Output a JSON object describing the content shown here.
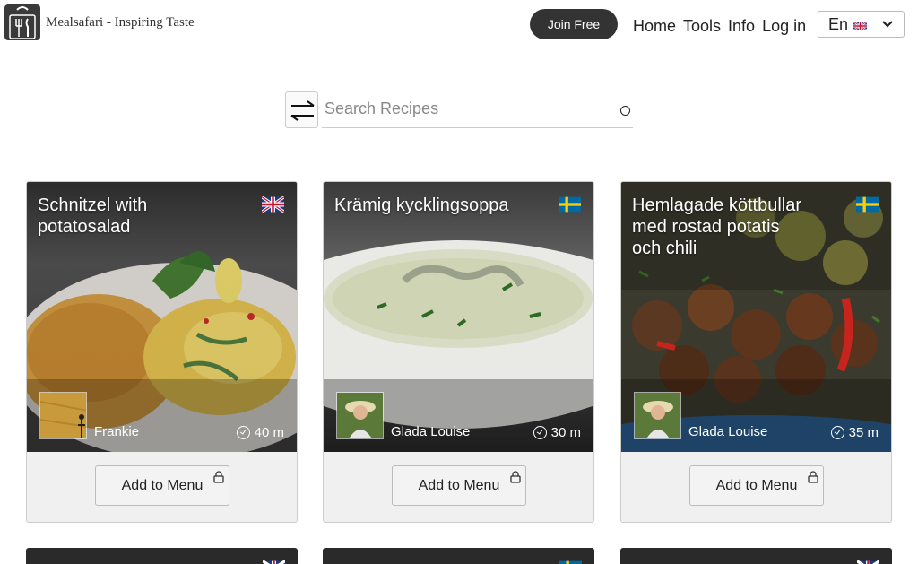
{
  "header": {
    "brand": "Mealsafari - Inspiring Taste",
    "join_label": "Join Free",
    "nav": [
      "Home",
      "Tools",
      "Info",
      "Log in"
    ],
    "language": "En"
  },
  "search": {
    "placeholder": "Search Recipes"
  },
  "recipes": [
    {
      "title": "Schnitzel with potatosalad",
      "flag": "uk",
      "author": "Frankie",
      "time": "40 m",
      "button": "Add to Menu"
    },
    {
      "title": "Krämig kycklingsoppa",
      "flag": "se",
      "author": "Glada Louise",
      "time": "30 m",
      "button": "Add to Menu"
    },
    {
      "title": "Hemlagade köttbullar med rostad potatis och chili",
      "flag": "se",
      "author": "Glada Louise",
      "time": "35 m",
      "button": "Add to Menu"
    }
  ],
  "colors": {
    "join_bg": "#333333",
    "card_bg": "#f0f0f0"
  }
}
